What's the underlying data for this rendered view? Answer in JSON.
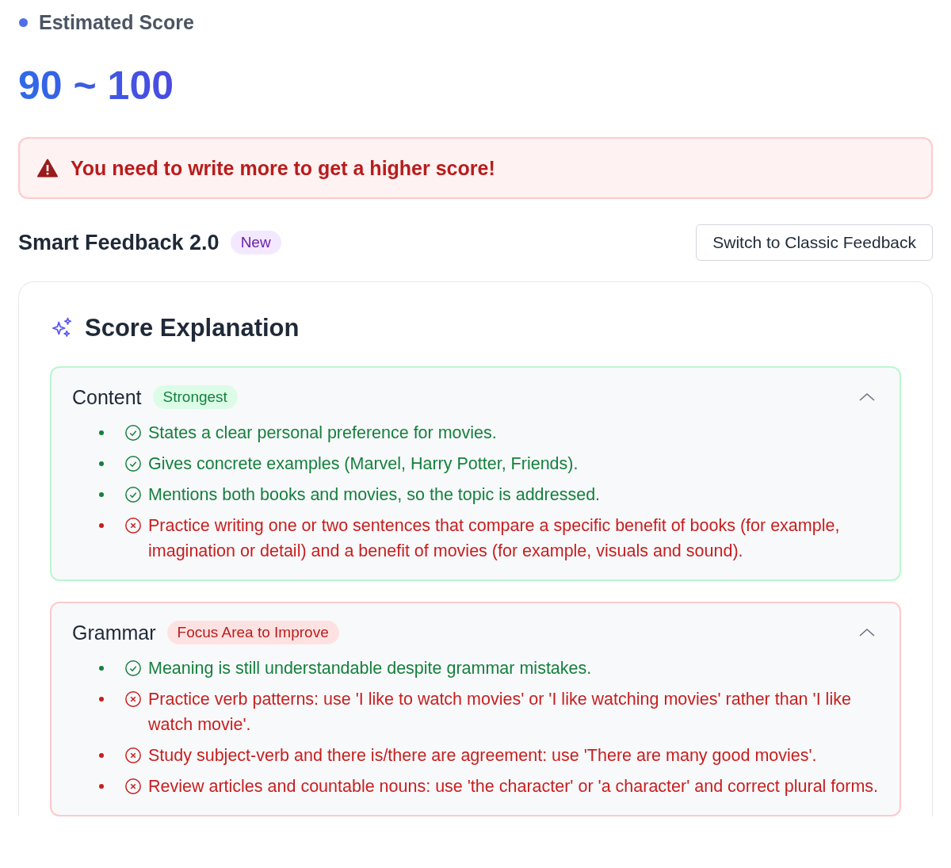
{
  "estimated_score": {
    "label": "Estimated Score",
    "value": "90 ~ 100"
  },
  "alert": {
    "message": "You need to write more to get a higher score!"
  },
  "feedback_header": {
    "title": "Smart Feedback 2.0",
    "badge": "New",
    "switch_button": "Switch to Classic Feedback"
  },
  "score_explanation": {
    "title": "Score Explanation",
    "sections": [
      {
        "title": "Content",
        "badge": "Strongest",
        "kind": "strength",
        "expanded": true,
        "items": [
          {
            "kind": "positive",
            "text": "States a clear personal preference for movies."
          },
          {
            "kind": "positive",
            "text": "Gives concrete examples (Marvel, Harry Potter, Friends)."
          },
          {
            "kind": "positive",
            "text": "Mentions both books and movies, so the topic is addressed."
          },
          {
            "kind": "negative",
            "text": "Practice writing one or two sentences that compare a specific benefit of books (for example, imagination or detail) and a benefit of movies (for example, visuals and sound)."
          }
        ]
      },
      {
        "title": "Grammar",
        "badge": "Focus Area to Improve",
        "kind": "weakness",
        "expanded": true,
        "items": [
          {
            "kind": "positive",
            "text": "Meaning is still understandable despite grammar mistakes."
          },
          {
            "kind": "negative",
            "text": "Practice verb patterns: use 'I like to watch movies' or 'I like watching movies' rather than 'I like watch movie'."
          },
          {
            "kind": "negative",
            "text": "Study subject-verb and there is/there are agreement: use 'There are many good movies'."
          },
          {
            "kind": "negative",
            "text": "Review articles and countable nouns: use 'the character' or 'a character' and correct plural forms."
          }
        ]
      }
    ]
  }
}
